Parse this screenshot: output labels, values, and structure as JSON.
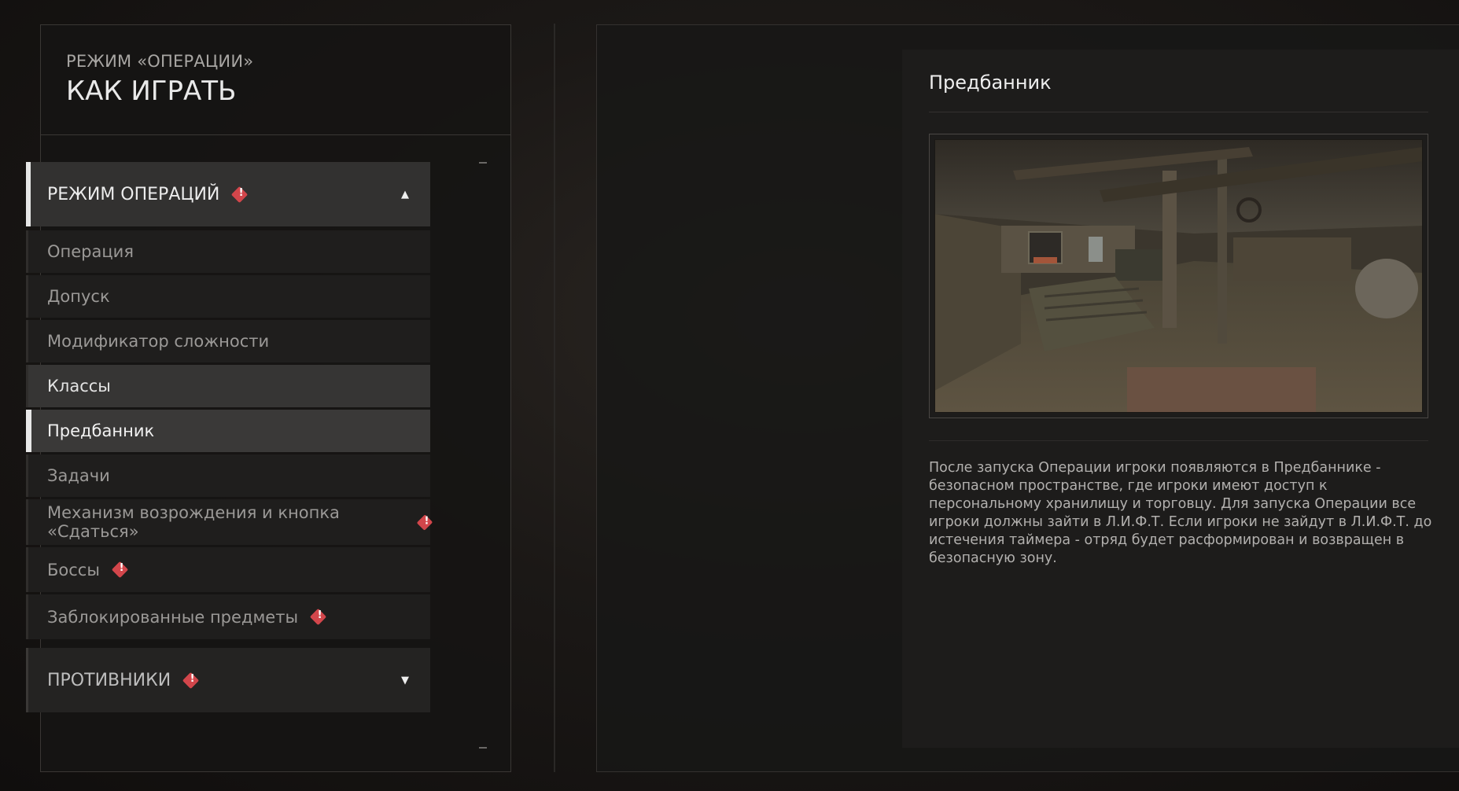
{
  "left": {
    "subtitle": "РЕЖИМ «ОПЕРАЦИИ»",
    "title": "КАК ИГРАТЬ",
    "section_open": {
      "label": "РЕЖИМ ОПЕРАЦИЙ",
      "expanded": true
    },
    "items": [
      {
        "label": "Операция"
      },
      {
        "label": "Допуск"
      },
      {
        "label": "Модификатор сложности"
      },
      {
        "label": "Классы"
      },
      {
        "label": "Предбанник"
      },
      {
        "label": "Задачи"
      },
      {
        "label": "Механизм возрождения и кнопка «Сдаться»"
      },
      {
        "label": "Боссы"
      },
      {
        "label": "Заблокированные предметы"
      }
    ],
    "section_closed": {
      "label": "ПРОТИВНИКИ",
      "expanded": false
    }
  },
  "content": {
    "title": "Предбанник",
    "description": "После запуска Операции игроки появляются в Предбаннике - безопасном пространстве, где игроки имеют доступ к персональному хранилищу и торговцу. Для запуска Операции все игроки должны зайти в Л.И.Ф.Т. Если игроки не зайдут в Л.И.Ф.Т. до истечения таймера - отряд будет расформирован и возвращен в безопасную зону."
  },
  "colors": {
    "accent_warning": "#d2464b",
    "active_marker": "#e8e8e8"
  }
}
